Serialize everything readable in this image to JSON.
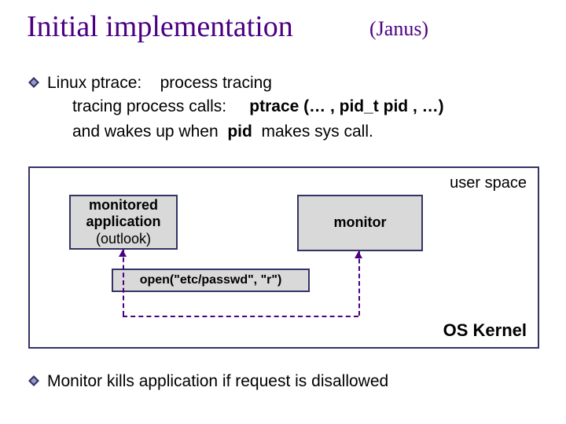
{
  "slide": {
    "title": "Initial implementation",
    "subtitle": "(Janus)",
    "bullet1_lead": "Linux ptrace:",
    "bullet1_tail": "process tracing",
    "line2_a": "tracing process calls:",
    "line2_b": "ptrace (… ,  pid_t  pid ,  …)",
    "line3_a": "and wakes up when",
    "line3_b": "pid",
    "line3_c": "makes sys call.",
    "bullet2": "Monitor kills application if request is disallowed"
  },
  "diagram": {
    "user_space": "user space",
    "kernel": "OS Kernel",
    "app_l1": "monitored",
    "app_l2": "application",
    "app_l3": "(outlook)",
    "monitor": "monitor",
    "call": "open(\"etc/passwd\", \"r\")"
  }
}
